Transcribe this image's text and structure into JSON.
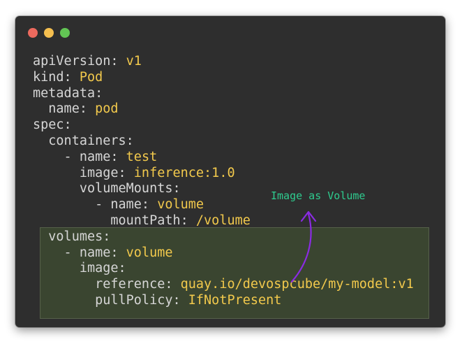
{
  "window": {
    "buttons": [
      {
        "name": "close",
        "color": "#ed6a5e"
      },
      {
        "name": "minimize",
        "color": "#f5bf4f"
      },
      {
        "name": "maximize",
        "color": "#62c554"
      }
    ]
  },
  "code": {
    "lines": [
      {
        "indent": "",
        "dash": "",
        "key": "apiVersion:",
        "value": "v1"
      },
      {
        "indent": "",
        "dash": "",
        "key": "kind:",
        "value": "Pod"
      },
      {
        "indent": "",
        "dash": "",
        "key": "metadata:",
        "value": ""
      },
      {
        "indent": "  ",
        "dash": "",
        "key": "name:",
        "value": "pod"
      },
      {
        "indent": "",
        "dash": "",
        "key": "spec:",
        "value": ""
      },
      {
        "indent": "  ",
        "dash": "",
        "key": "containers:",
        "value": ""
      },
      {
        "indent": "    ",
        "dash": "- ",
        "key": "name:",
        "value": "test"
      },
      {
        "indent": "      ",
        "dash": "",
        "key": "image:",
        "value": "inference:1.0"
      },
      {
        "indent": "      ",
        "dash": "",
        "key": "volumeMounts:",
        "value": ""
      },
      {
        "indent": "        ",
        "dash": "- ",
        "key": "name:",
        "value": "volume"
      },
      {
        "indent": "          ",
        "dash": "",
        "key": "mountPath:",
        "value": "/volume"
      },
      {
        "indent": "  ",
        "dash": "",
        "key": "volumes:",
        "value": ""
      },
      {
        "indent": "    ",
        "dash": "- ",
        "key": "name:",
        "value": "volume"
      },
      {
        "indent": "      ",
        "dash": "",
        "key": "image:",
        "value": ""
      },
      {
        "indent": "        ",
        "dash": "",
        "key": "reference:",
        "value": "quay.io/devospcube/my-model:v1"
      },
      {
        "indent": "        ",
        "dash": "",
        "key": "pullPolicy:",
        "value": "IfNotPresent"
      }
    ]
  },
  "annotation": {
    "text": "Image as Volume",
    "color": "#2ecc8f",
    "arrow_color": "#8a2be2"
  }
}
